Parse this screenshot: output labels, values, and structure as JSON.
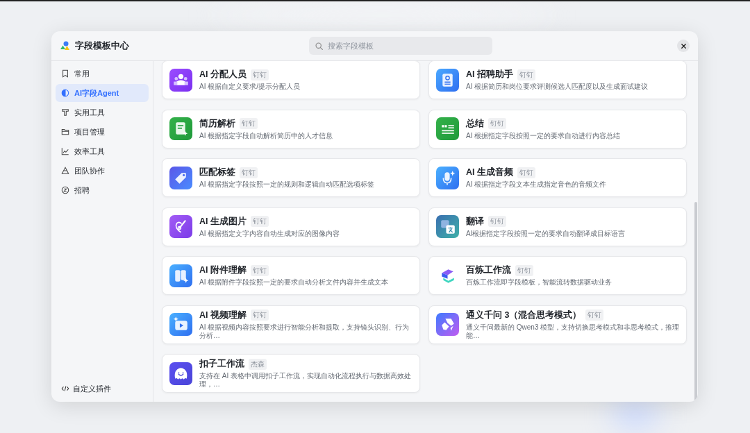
{
  "dialog": {
    "title": "字段模板中心",
    "search": {
      "placeholder": "搜索字段模板"
    }
  },
  "sidebar": {
    "items": [
      {
        "label": "常用",
        "selected": false
      },
      {
        "label": "AI字段Agent",
        "selected": true
      },
      {
        "label": "实用工具",
        "selected": false
      },
      {
        "label": "项目管理",
        "selected": false
      },
      {
        "label": "效率工具",
        "selected": false
      },
      {
        "label": "团队协作",
        "selected": false
      },
      {
        "label": "招聘",
        "selected": false
      }
    ],
    "footer": {
      "label": "自定义插件"
    }
  },
  "templates": [
    {
      "title": "AI 分配人员",
      "badge": "钉钉",
      "description": "AI 根据自定义要求/提示分配人员"
    },
    {
      "title": "AI 招聘助手",
      "badge": "钉钉",
      "description": "AI 根据简历和岗位要求评测候选人匹配度以及生成面试建议"
    },
    {
      "title": "简历解析",
      "badge": "钉钉",
      "description": "AI 根据指定字段自动解析简历中的人才信息"
    },
    {
      "title": "总结",
      "badge": "钉钉",
      "description": "AI 根据指定字段按照一定的要求自动进行内容总结"
    },
    {
      "title": "匹配标签",
      "badge": "钉钉",
      "description": "AI 根据指定字段按照一定的规则和逻辑自动匹配选项标签"
    },
    {
      "title": "AI 生成音频",
      "badge": "钉钉",
      "description": "AI 根据指定字段文本生成指定音色的音频文件"
    },
    {
      "title": "AI 生成图片",
      "badge": "钉钉",
      "description": "AI 根据指定文字内容自动生成对应的图像内容"
    },
    {
      "title": "翻译",
      "badge": "钉钉",
      "description": "AI根据指定字段按照一定的要求自动翻译成目标语言"
    },
    {
      "title": "AI 附件理解",
      "badge": "钉钉",
      "description": "AI 根据附件字段按照一定的要求自动分析文件内容并生成文本"
    },
    {
      "title": "百炼工作流",
      "badge": "钉钉",
      "description": "百炼工作流即字段模板，智能流转数据驱动业务"
    },
    {
      "title": "AI 视频理解",
      "badge": "钉钉",
      "description": "AI 根据视频内容按照要求进行智能分析和提取，支持镜头识别、行为分析…"
    },
    {
      "title": "通义千问 3（混合思考模式）",
      "badge": "钉钉",
      "description": "通义千问最新的 Qwen3 模型，支持切换思考模式和非思考模式，推理能…"
    },
    {
      "title": "扣子工作流",
      "badge": "杰森",
      "description": "支持在 AI 表格中调用扣子工作流，实现自动化流程执行与数据高效处理，…"
    }
  ]
}
